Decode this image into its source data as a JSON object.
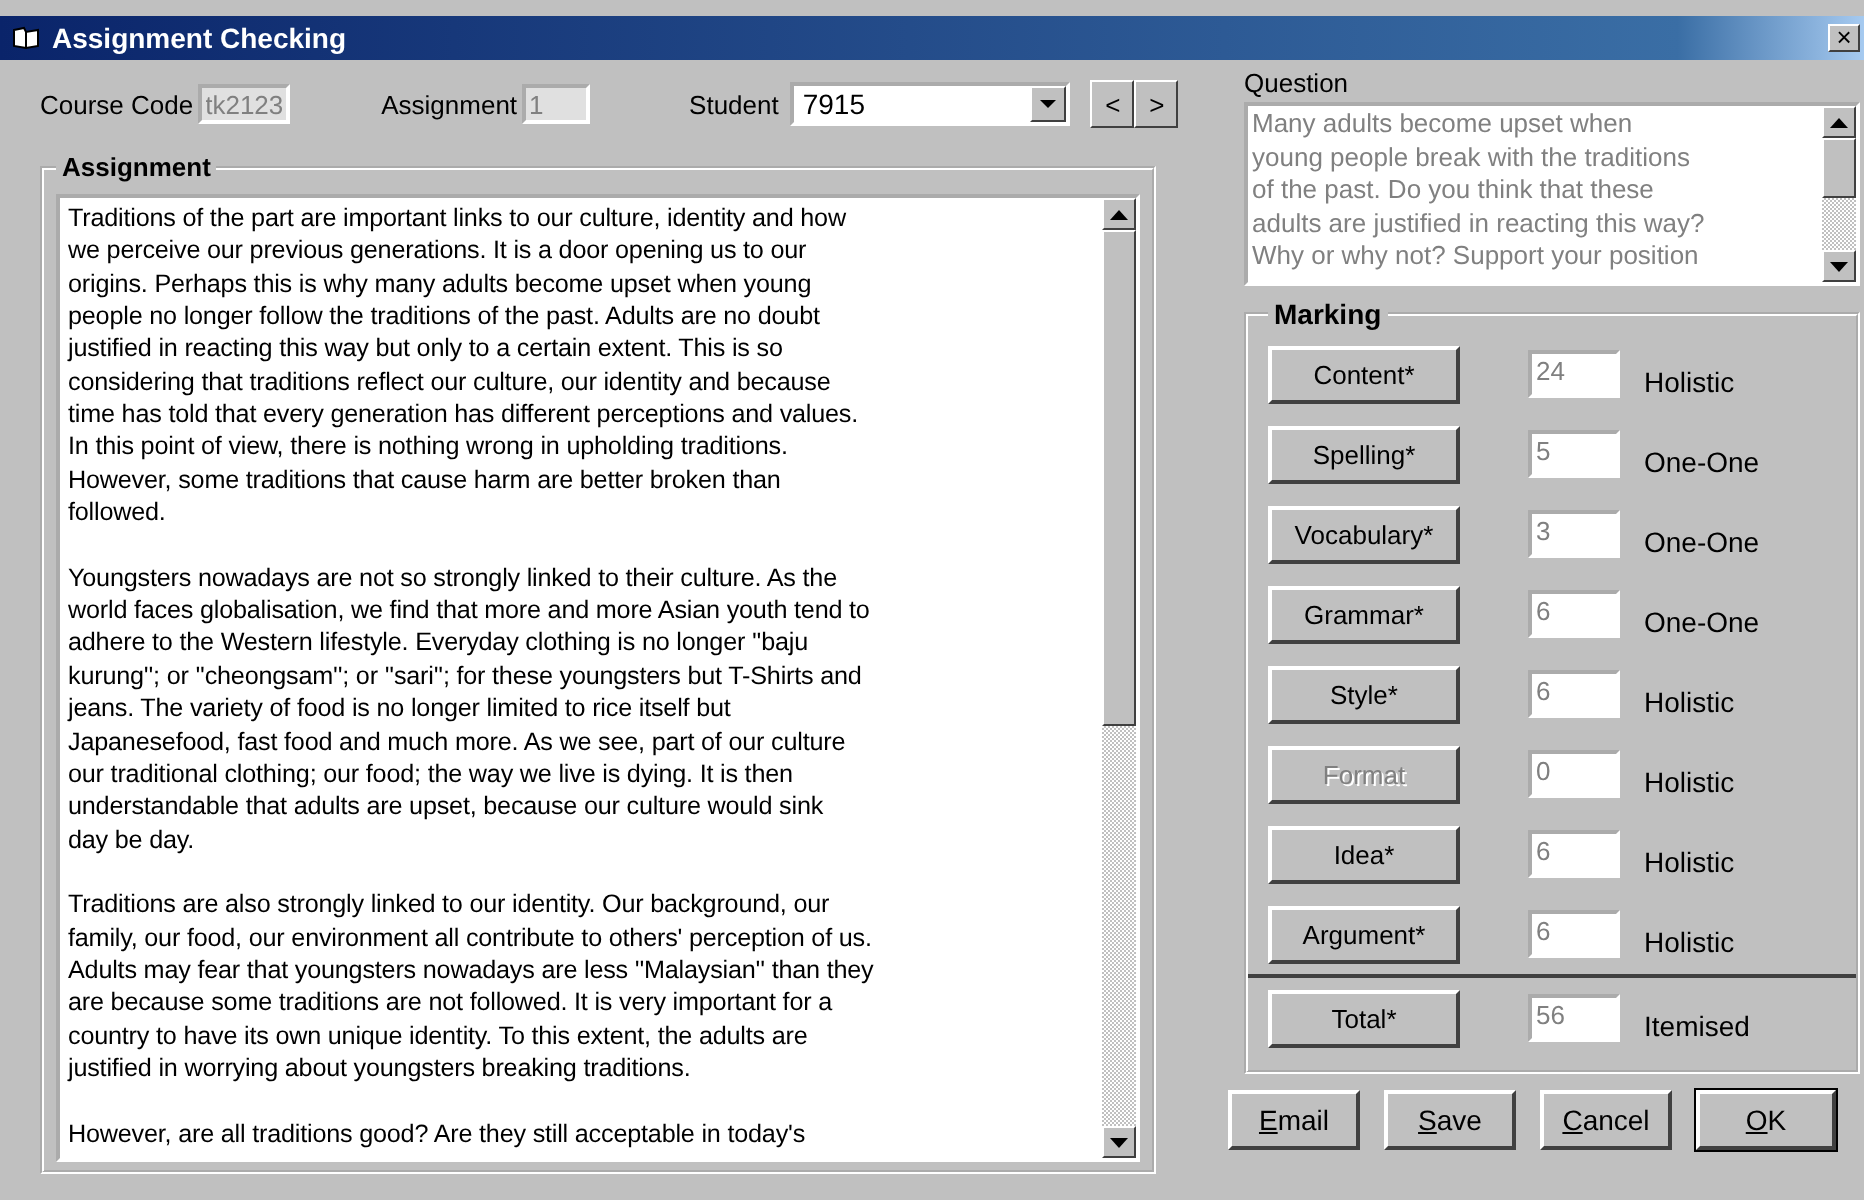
{
  "window": {
    "title": "Assignment Checking",
    "close": "×"
  },
  "header": {
    "course_code": {
      "label": "Course Code",
      "value": "tk2123",
      "disabled": true
    },
    "assignment": {
      "label": "Assignment",
      "value": "1",
      "disabled": true
    },
    "student": {
      "label": "Student",
      "value": "7915"
    },
    "nav": [
      "<",
      ">"
    ]
  },
  "assignment_panel": {
    "title": "Assignment",
    "paragraphs": [
      [
        "Traditions of the part are important links to our culture, identity and how",
        "we perceive our previous generations. It is a door opening us to our",
        "origins. Perhaps this is why many adults become upset when young",
        "people no longer follow the traditions of the past. Adults are no doubt",
        "justified in reacting this way but only to a certain extent. This is so",
        "considering that traditions reflect our culture, our identity and because",
        "time has told that every generation has different perceptions and values.",
        "In this point of view, there is nothing wrong in upholding traditions.",
        "However, some traditions that cause harm are better broken than",
        "followed."
      ],
      [
        "Youngsters nowadays are not so strongly linked to their culture. As the",
        "world faces globalisation, we find that more and more Asian youth tend to",
        "adhere to the Western lifestyle. Everyday clothing is no longer ''baju",
        "kurung''; or ''cheongsam''; or ''sari''; for these youngsters but T-Shirts and",
        "jeans. The variety of food is no longer limited to rice itself but",
        "Japanesefood, fast food and much more. As we see, part of our culture",
        "our traditional clothing; our food; the way we live is dying. It is then",
        "understandable that adults are upset, because our culture would sink",
        "day be day."
      ],
      [
        "Traditions are also strongly linked to our identity. Our background, our",
        "family, our food, our environment all contribute to others' perception of us.",
        "Adults may fear that youngsters nowadays are less ''Malaysian'' than they",
        "are because some traditions are not followed. It is very important for a",
        "country to have its own unique identity. To this extent, the adults are",
        "justified in worrying about youngsters breaking traditions."
      ],
      [
        "However, are all traditions good? Are they still acceptable in today's"
      ]
    ]
  },
  "question": {
    "label": "Question",
    "lines": [
      "Many adults become upset when",
      "young people break with the traditions",
      "of the past. Do you think that these",
      "adults are justified in reacting this way?",
      "Why or why not? Support your position"
    ]
  },
  "marking": {
    "title": "Marking",
    "rows": [
      {
        "label": "Content*",
        "value": "24",
        "method": "Holistic",
        "disabled": false
      },
      {
        "label": "Spelling*",
        "value": "5",
        "method": "One-One",
        "disabled": false
      },
      {
        "label": "Vocabulary*",
        "value": "3",
        "method": "One-One",
        "disabled": false
      },
      {
        "label": "Grammar*",
        "value": "6",
        "method": "One-One",
        "disabled": false
      },
      {
        "label": "Style*",
        "value": "6",
        "method": "Holistic",
        "disabled": false
      },
      {
        "label": "Format",
        "value": "0",
        "method": "Holistic",
        "disabled": true
      },
      {
        "label": "Idea*",
        "value": "6",
        "method": "Holistic",
        "disabled": false
      },
      {
        "label": "Argument*",
        "value": "6",
        "method": "Holistic",
        "disabled": false
      }
    ],
    "total": {
      "label": "Total*",
      "value": "56",
      "method": "Itemised",
      "disabled": false
    }
  },
  "buttons": [
    {
      "accel": "E",
      "rest": "mail",
      "default": false
    },
    {
      "accel": "S",
      "rest": "ave",
      "default": false
    },
    {
      "accel": "C",
      "rest": "ancel",
      "default": false
    },
    {
      "accel": "O",
      "rest": "K",
      "default": true
    }
  ]
}
